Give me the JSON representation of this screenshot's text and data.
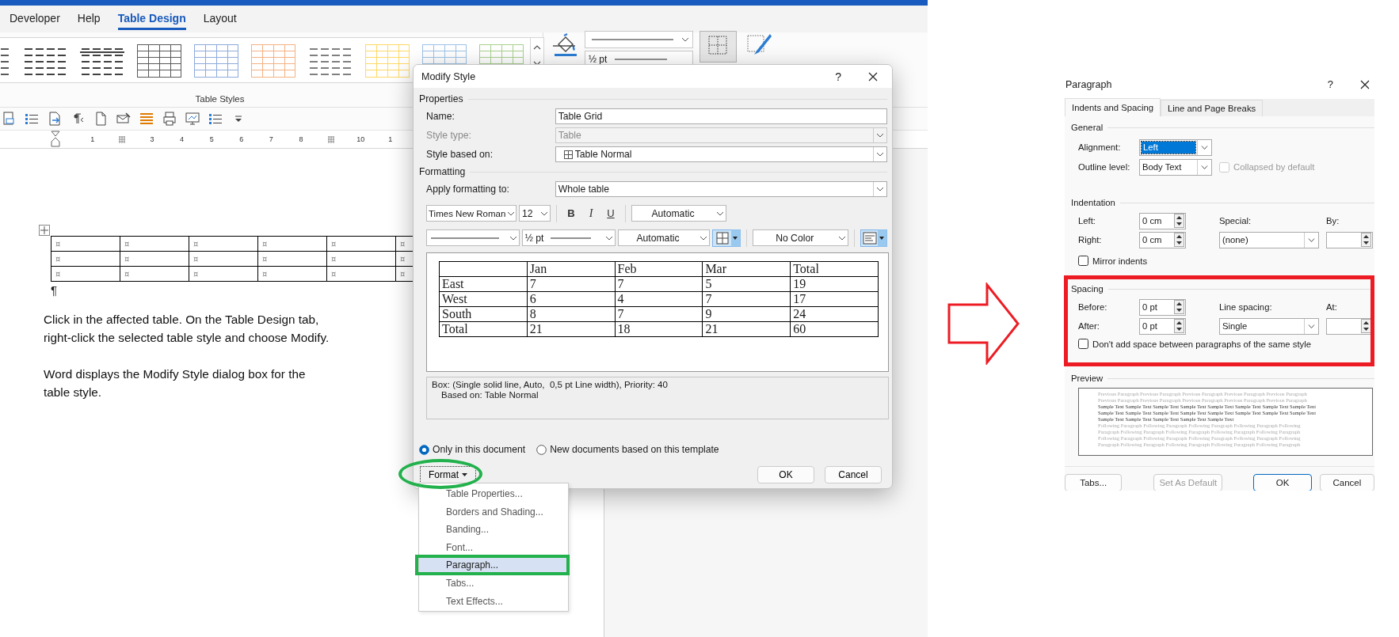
{
  "ribbon": {
    "tabs": [
      {
        "label": "Developer",
        "selected": false
      },
      {
        "label": "Help",
        "selected": false
      },
      {
        "label": "Table Design",
        "selected": true
      },
      {
        "label": "Layout",
        "selected": false
      }
    ],
    "table_styles": [
      {
        "kind": "lines",
        "color": "#595959"
      },
      {
        "kind": "lines",
        "color": "#404040"
      },
      {
        "kind": "header",
        "color": "#404040"
      },
      {
        "kind": "boxed",
        "color": "#595959"
      },
      {
        "kind": "boxed",
        "color": "#8eaadb"
      },
      {
        "kind": "boxed",
        "color": "#f4b183"
      },
      {
        "kind": "lines",
        "color": "#7f7f7f"
      },
      {
        "kind": "boxed",
        "color": "#ffd966"
      },
      {
        "kind": "boxed",
        "color": "#9dc3e6"
      },
      {
        "kind": "boxed",
        "color": "#a9d18e"
      }
    ],
    "group_label": "Table Styles",
    "pen_weight": "½ pt"
  },
  "ruler": [
    {
      "kind": "number",
      "text": "1"
    },
    {
      "kind": "tab"
    },
    {
      "kind": "number",
      "text": "3"
    },
    {
      "kind": "number",
      "text": "4"
    },
    {
      "kind": "number",
      "text": "5"
    },
    {
      "kind": "number",
      "text": "6"
    },
    {
      "kind": "number",
      "text": "7"
    },
    {
      "kind": "number",
      "text": "8"
    },
    {
      "kind": "tab"
    },
    {
      "kind": "number",
      "text": "10"
    },
    {
      "kind": "number",
      "text": "1"
    }
  ],
  "document": {
    "table_rows": [
      [
        "¤",
        "¤",
        "¤",
        "¤",
        "¤",
        "¤"
      ],
      [
        "¤",
        "¤",
        "¤",
        "¤",
        "¤",
        "¤"
      ],
      [
        "¤",
        "¤",
        "¤",
        "¤",
        "¤",
        "¤"
      ]
    ],
    "paragraph_mark": "¶",
    "paragraphs": [
      {
        "lines": [
          "Click in the affected table. On the Table Design tab,",
          "right-click the selected table style and choose Modify."
        ]
      },
      {
        "lines": [
          "Word displays the Modify Style dialog box for the",
          "table style."
        ]
      }
    ]
  },
  "modify_style": {
    "title": "Modify Style",
    "help": "?",
    "properties": "Properties",
    "fields": [
      {
        "label": "Name:",
        "value": "Table Grid",
        "kind": "text",
        "disabled": false
      },
      {
        "label": "Style type:",
        "value": "Table",
        "kind": "dropdown",
        "disabled": true
      },
      {
        "label": "Style based on:",
        "value": "Table Normal",
        "kind": "table-dropdown",
        "disabled": false
      }
    ],
    "formatting": "Formatting",
    "apply": {
      "label": "Apply formatting to:",
      "value": "Whole table"
    },
    "font": "Times New Roman",
    "size": "12",
    "styles": [
      {
        "text": "B",
        "kind": "bold"
      },
      {
        "text": "I",
        "kind": "italic"
      },
      {
        "text": "U",
        "kind": "underline"
      }
    ],
    "font_color": "Automatic",
    "border_weight": "½ pt",
    "border_color": "Automatic",
    "shading": "No Color",
    "preview": {
      "columns": [
        "Jan",
        "Feb",
        "Mar",
        "Total"
      ],
      "rows": [
        {
          "label": "East",
          "values": [
            "7",
            "7",
            "5",
            "19"
          ]
        },
        {
          "label": "West",
          "values": [
            "6",
            "4",
            "7",
            "17"
          ]
        },
        {
          "label": "South",
          "values": [
            "8",
            "7",
            "9",
            "24"
          ]
        },
        {
          "label": "Total",
          "values": [
            "21",
            "18",
            "21",
            "60"
          ]
        }
      ]
    },
    "description": [
      "Box: (Single solid line, Auto,  0,5 pt Line width), Priority: 40",
      "Based on: Table Normal"
    ],
    "radios": [
      {
        "label": "Only in this document",
        "selected": true
      },
      {
        "label": "New documents based on this template",
        "selected": false
      }
    ],
    "format_button": "Format",
    "ok": "OK",
    "cancel": "Cancel"
  },
  "format_menu": [
    {
      "label": "Table Properties...",
      "selected": false
    },
    {
      "label": "Borders and Shading...",
      "selected": false
    },
    {
      "label": "Banding...",
      "selected": false
    },
    {
      "label": "Font...",
      "selected": false
    },
    {
      "label": "Paragraph...",
      "selected": true
    },
    {
      "label": "Tabs...",
      "selected": false
    },
    {
      "label": "Text Effects...",
      "selected": false
    }
  ],
  "paragraph": {
    "title": "Paragraph",
    "help": "?",
    "tabs": [
      {
        "label": "Indents and Spacing",
        "selected": true
      },
      {
        "label": "Line and Page Breaks",
        "selected": false
      }
    ],
    "general": "General",
    "alignment": {
      "label": "Alignment:",
      "value": "Left"
    },
    "outline": {
      "label": "Outline level:",
      "value": "Body Text"
    },
    "collapsed": {
      "label": "Collapsed by default",
      "checked": false,
      "disabled": true
    },
    "indentation": "Indentation",
    "left": {
      "label": "Left:",
      "value": "0 cm"
    },
    "right": {
      "label": "Right:",
      "value": "0 cm"
    },
    "special": {
      "label": "Special:",
      "value": "(none)"
    },
    "by": {
      "label": "By:"
    },
    "mirror": {
      "label": "Mirror indents",
      "checked": false
    },
    "spacing": "Spacing",
    "before": {
      "label": "Before:",
      "value": "0 pt"
    },
    "after": {
      "label": "After:",
      "value": "0 pt"
    },
    "line_spacing": {
      "label": "Line spacing:",
      "value": "Single"
    },
    "at": {
      "label": "At:"
    },
    "dont_add": {
      "label": "Don't add space between paragraphs of the same style",
      "checked": false
    },
    "preview": "Preview",
    "preview_lines": [
      {
        "kind": "previous",
        "text": "Previous Paragraph Previous Paragraph Previous Paragraph Previous Paragraph Previous Paragraph"
      },
      {
        "kind": "previous",
        "text": "Previous Paragraph Previous Paragraph Previous Paragraph Previous Paragraph Previous Paragraph"
      },
      {
        "kind": "sample",
        "text": "Sample Text Sample Text Sample Text Sample Text Sample Text Sample Text Sample Text Sample Text"
      },
      {
        "kind": "sample",
        "text": "Sample Text Sample Text Sample Text Sample Text Sample Text Sample Text Sample Text Sample Text"
      },
      {
        "kind": "sample",
        "text": "Sample Text Sample Text Sample Text Sample Text Sample Text"
      },
      {
        "kind": "following",
        "text": "Following Paragraph Following Paragraph Following Paragraph Following Paragraph Following"
      },
      {
        "kind": "following",
        "text": "Paragraph Following Paragraph Following Paragraph Following Paragraph Following Paragraph"
      },
      {
        "kind": "following",
        "text": "Following Paragraph Following Paragraph Following Paragraph Following Paragraph Following"
      },
      {
        "kind": "following",
        "text": "Paragraph Following Paragraph Following Paragraph Following Paragraph Following Paragraph"
      }
    ],
    "buttons": [
      {
        "label": "Tabs...",
        "kind": "normal"
      },
      {
        "label": "Set As Default",
        "kind": "disabled"
      },
      {
        "label": "OK",
        "kind": "default"
      },
      {
        "label": "Cancel",
        "kind": "normal"
      }
    ]
  }
}
